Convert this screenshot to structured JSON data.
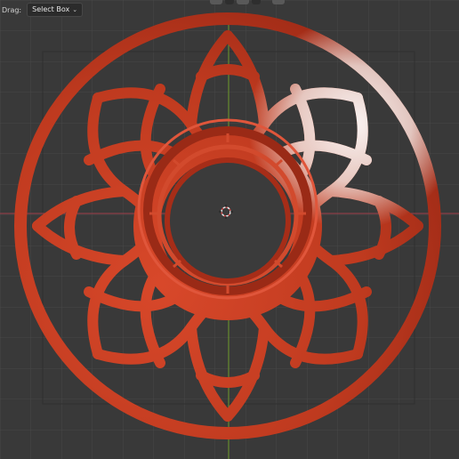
{
  "header": {
    "drag_label": "Drag:",
    "select_mode_value": "Select Box",
    "dropdown_icon": "chevron-down-icon"
  },
  "viewport": {
    "background_color": "#393939",
    "grid_color": "#474747",
    "x_axis_color": "#a1404a",
    "y_axis_color": "#6e9a2c",
    "object_color": "#c8381e",
    "object_highlight_color": "#f3f1f0",
    "icons": [
      "3d-cursor-icon"
    ]
  }
}
